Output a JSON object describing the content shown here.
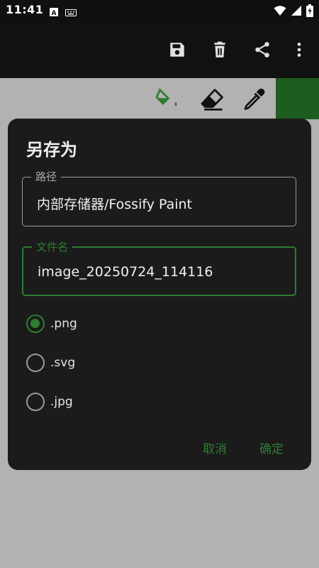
{
  "status_bar": {
    "time": "11:41"
  },
  "app_bar": {
    "actions": [
      "save-icon",
      "delete-icon",
      "share-icon",
      "more-icon"
    ]
  },
  "toolbar": {
    "tools": [
      "fill-bucket-icon",
      "eraser-icon",
      "color-picker-icon"
    ],
    "selected_color": "#1f5c1f"
  },
  "dialog": {
    "title": "另存为",
    "path_label": "路径",
    "path_value": "内部存储器/Fossify Paint",
    "filename_label": "文件名",
    "filename_value": "image_20250724_114116",
    "formats": [
      {
        "label": ".png",
        "selected": true
      },
      {
        "label": ".svg",
        "selected": false
      },
      {
        "label": ".jpg",
        "selected": false
      }
    ],
    "cancel_label": "取消",
    "confirm_label": "确定"
  },
  "colors": {
    "accent": "#2e7d32",
    "dialog_bg": "#1b1b1b",
    "canvas_bg": "#b2b2b2"
  }
}
